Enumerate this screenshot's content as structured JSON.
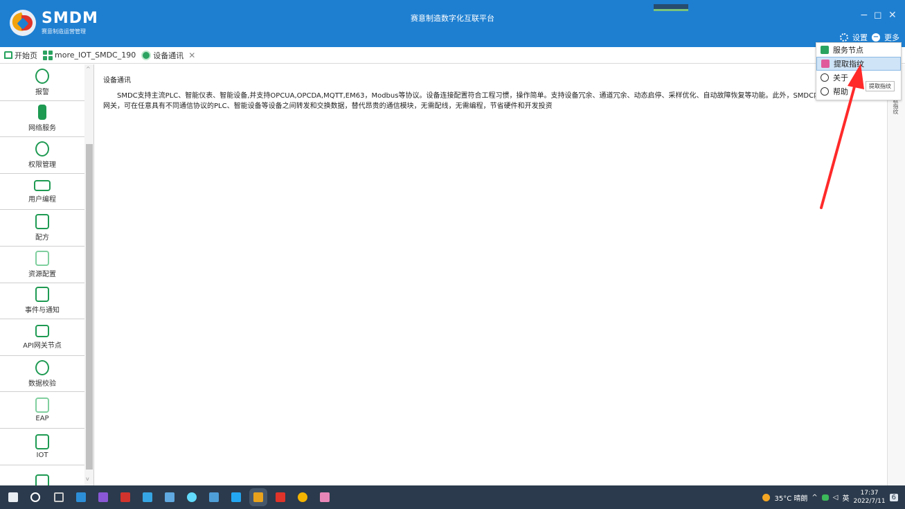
{
  "app": {
    "logo_title": "SMDM",
    "logo_subtitle": "赛意制造运营管理",
    "window_title": "赛意制造数字化互联平台",
    "minimize": "−",
    "restore": "◻",
    "close": "✕",
    "settings_label": "设置",
    "more_label": "更多"
  },
  "tabs": [
    {
      "label": "开始页"
    },
    {
      "label": "more_IOT_SMDC_190"
    },
    {
      "label": "设备通讯"
    }
  ],
  "sidebar": {
    "items": [
      {
        "label": "报警",
        "icon": "alarm-icon"
      },
      {
        "label": "网络服务",
        "icon": "network-service-icon"
      },
      {
        "label": "权限管理",
        "icon": "users-icon"
      },
      {
        "label": "用户编程",
        "icon": "monitor-icon"
      },
      {
        "label": "配方",
        "icon": "recipe-icon"
      },
      {
        "label": "资源配置",
        "icon": "calendar-icon"
      },
      {
        "label": "事件与通知",
        "icon": "event-icon"
      },
      {
        "label": "API网关节点",
        "icon": "gateway-icon"
      },
      {
        "label": "数据校验",
        "icon": "data-check-icon"
      },
      {
        "label": "EAP",
        "icon": "eap-icon"
      },
      {
        "label": "IOT",
        "icon": "iot-icon"
      },
      {
        "label": "",
        "icon": "robot-icon"
      }
    ]
  },
  "content": {
    "heading": "设备通讯",
    "description": "SMDC支持主流PLC、智能仪表、智能设备,并支持OPCUA,OPCDA,MQTT,EM63，Modbus等协议。设备连接配置符合工程习惯，操作简单。支持设备冗余、通道冗余、动态启停、采样优化、自动故障恢复等功能。此外，SMDC内置设备数据通信网关，可在任意具有不同通信协议的PLC、智能设备等设备之间转发和交换数据，替代昂贵的通信模块，无需配线，无需编程，节省硬件和开发投资"
  },
  "right_strip": {
    "label": "提取指纹"
  },
  "dropdown": {
    "items": [
      {
        "label": "服务节点",
        "icon": "server-node-icon",
        "color": "#2ba360"
      },
      {
        "label": "提取指纹",
        "icon": "fingerprint-icon",
        "color": "#e05a9b",
        "highlighted": true
      },
      {
        "label": "关于",
        "icon": "info-icon",
        "color": "#333333"
      },
      {
        "label": "帮助",
        "icon": "help-icon",
        "color": "#333333"
      }
    ],
    "tooltip": "提取指纹"
  },
  "taskbar": {
    "weather": "35°C 晴朗",
    "ime": "英",
    "time": "17:37",
    "date": "2022/7/11",
    "notification_count": "6"
  },
  "colors": {
    "title_bar": "#1e7fd1",
    "accent_green": "#1e9a52",
    "highlight": "#cfe4f7",
    "annotation_red": "#ff2a2a"
  }
}
